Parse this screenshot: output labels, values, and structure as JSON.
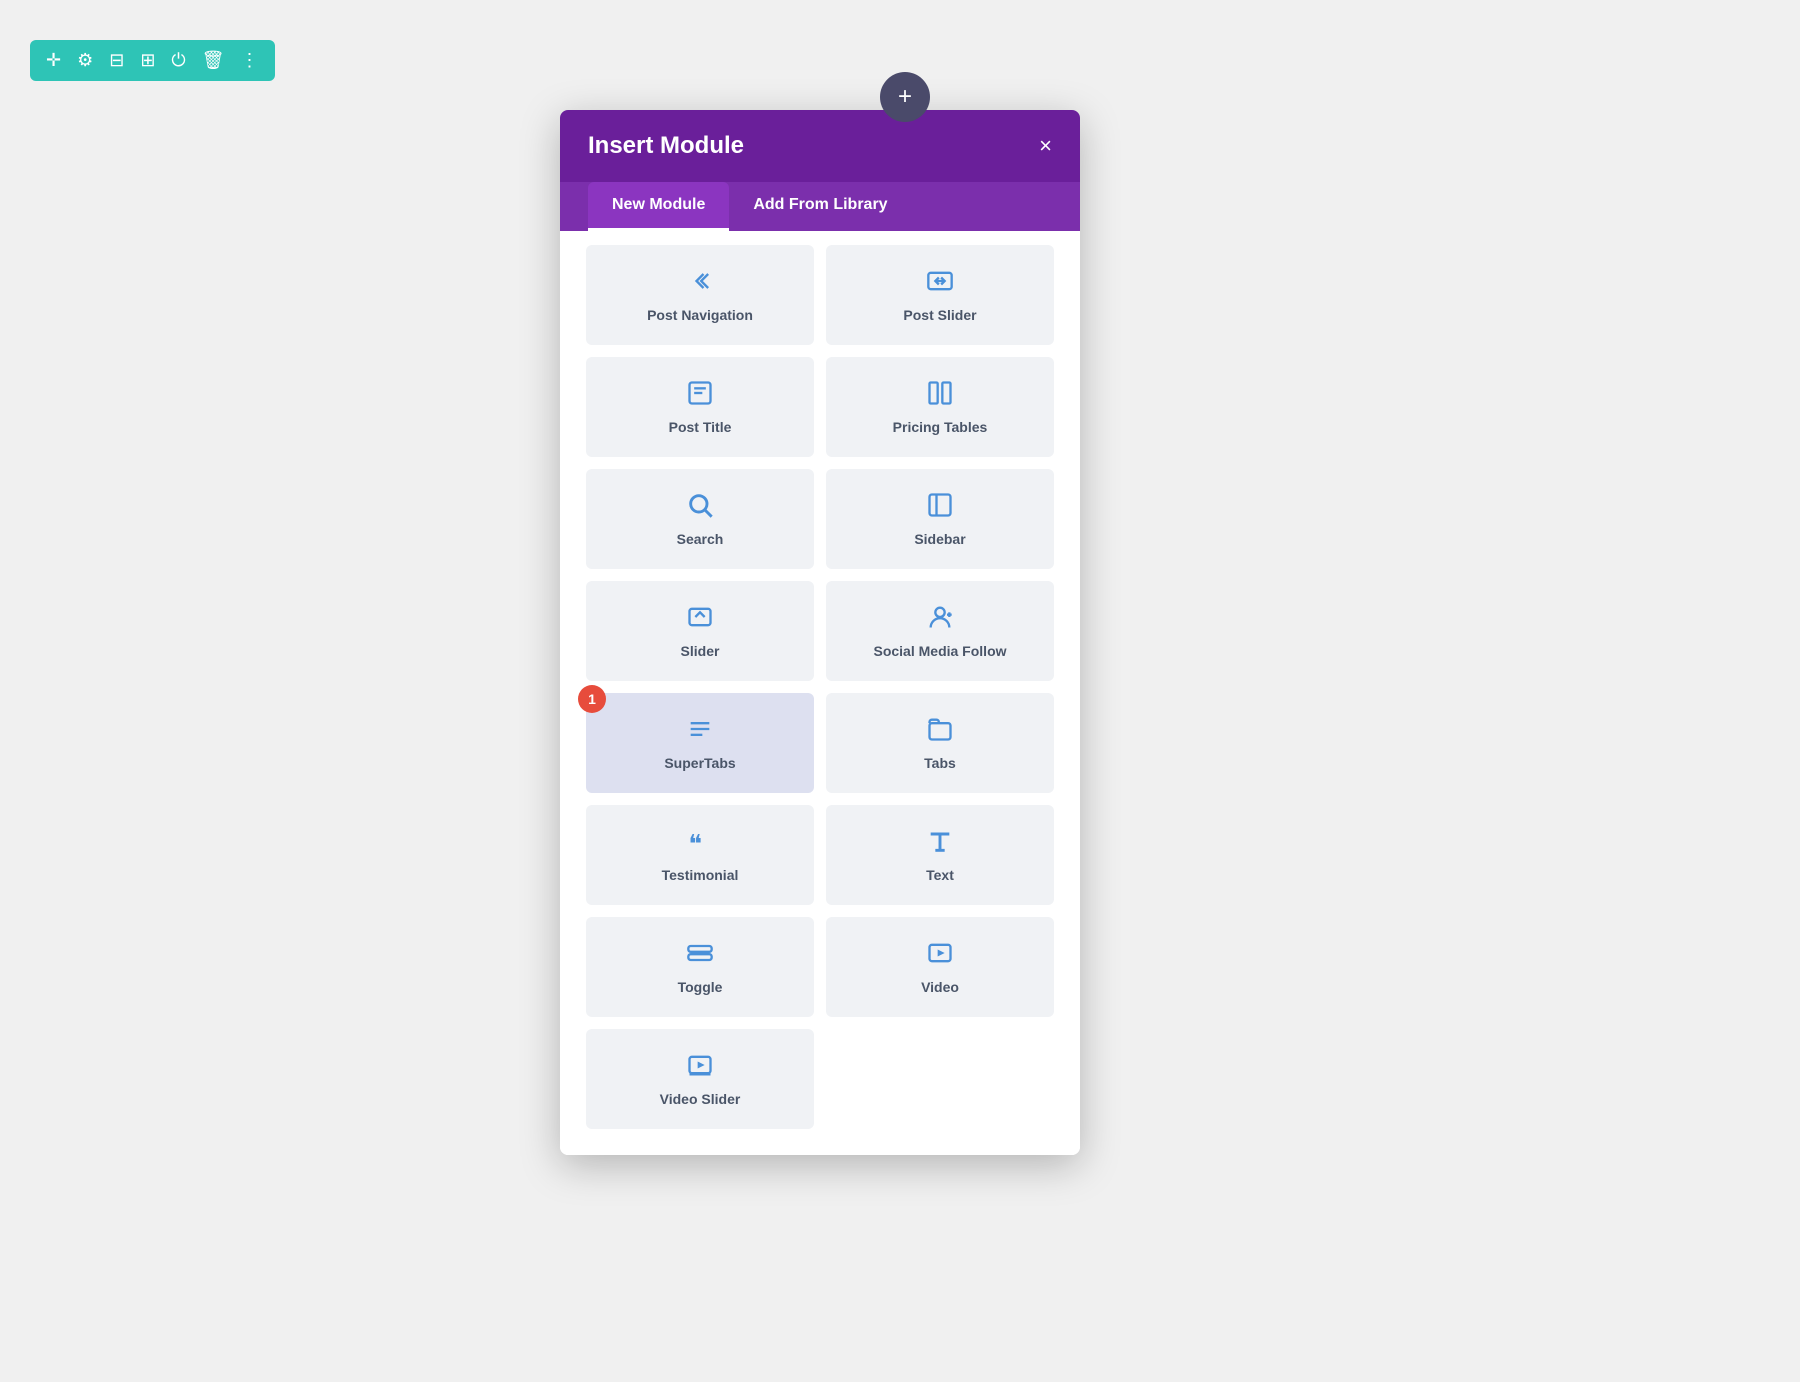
{
  "toolbar": {
    "bg_color": "#2ec4b6",
    "icons": [
      "move-icon",
      "settings-icon",
      "layout-icon",
      "columns-icon",
      "power-icon",
      "trash-icon",
      "more-icon"
    ]
  },
  "plus_button": {
    "label": "+"
  },
  "modal": {
    "title": "Insert Module",
    "close_label": "×",
    "tabs": [
      {
        "id": "new-module",
        "label": "New Module",
        "active": true
      },
      {
        "id": "add-from-library",
        "label": "Add From Library",
        "active": false
      }
    ],
    "modules": [
      {
        "id": "post-navigation",
        "label": "Post Navigation",
        "icon": "nav"
      },
      {
        "id": "post-slider",
        "label": "Post Slider",
        "icon": "slider2"
      },
      {
        "id": "post-title",
        "label": "Post Title",
        "icon": "post-title"
      },
      {
        "id": "pricing-tables",
        "label": "Pricing Tables",
        "icon": "pricing"
      },
      {
        "id": "search",
        "label": "Search",
        "icon": "search"
      },
      {
        "id": "sidebar",
        "label": "Sidebar",
        "icon": "sidebar"
      },
      {
        "id": "slider",
        "label": "Slider",
        "icon": "slider"
      },
      {
        "id": "social-media-follow",
        "label": "Social Media Follow",
        "icon": "social"
      },
      {
        "id": "supertabs",
        "label": "SuperTabs",
        "icon": "supertabs",
        "badge": "1",
        "active": true
      },
      {
        "id": "tabs",
        "label": "Tabs",
        "icon": "tabs"
      },
      {
        "id": "testimonial",
        "label": "Testimonial",
        "icon": "testimonial"
      },
      {
        "id": "text",
        "label": "Text",
        "icon": "text"
      },
      {
        "id": "toggle",
        "label": "Toggle",
        "icon": "toggle"
      },
      {
        "id": "video",
        "label": "Video",
        "icon": "video"
      },
      {
        "id": "video-slider",
        "label": "Video Slider",
        "icon": "video-slider"
      }
    ]
  }
}
